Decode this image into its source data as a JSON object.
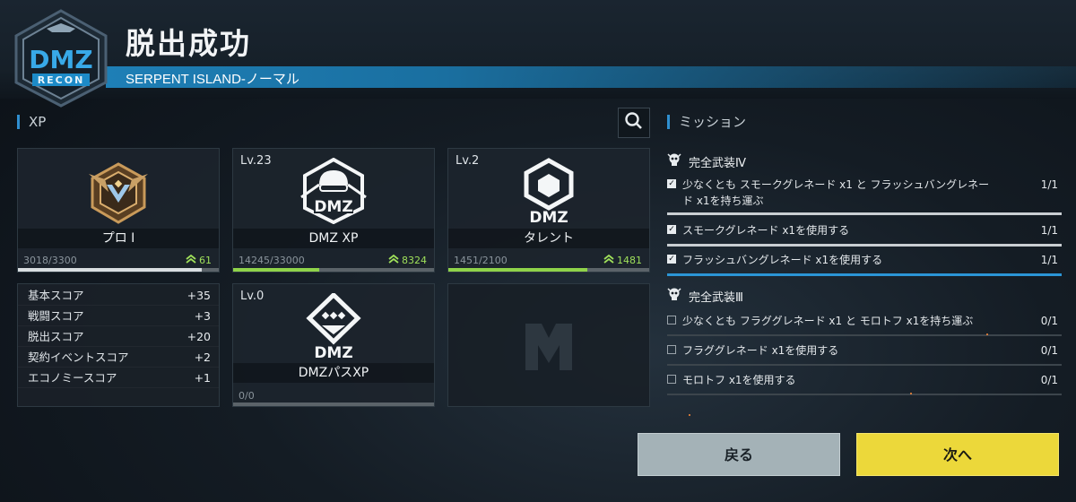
{
  "header": {
    "logo_text": "DMZ",
    "logo_subtext": "RECON",
    "title": "脱出成功",
    "subtitle": "SERPENT ISLAND-ノーマル"
  },
  "xp_section": {
    "label": "XP",
    "search_icon": "search-icon",
    "cards": [
      {
        "level": "",
        "name": "プロ I",
        "progress_text": "3018/3300",
        "progress": 0.915,
        "gain": "61",
        "icon": "rank-emblem-icon"
      },
      {
        "level": "Lv.23",
        "name": "DMZ XP",
        "progress_text": "14245/33000",
        "progress": 0.43,
        "gain": "8324",
        "icon": "dmz-operator-icon"
      },
      {
        "level": "Lv.2",
        "name": "タレント",
        "progress_text": "1451/2100",
        "progress": 0.69,
        "gain": "1481",
        "icon": "dmz-talent-icon"
      },
      {
        "level": "Lv.0",
        "name": "DMZパスXP",
        "progress_text": "0/0",
        "progress": 0,
        "gain": "",
        "icon": "dmz-pass-icon"
      }
    ],
    "emblem_text": "DMZ",
    "scores": [
      {
        "label": "基本スコア",
        "value": "+35"
      },
      {
        "label": "戦闘スコア",
        "value": "+3"
      },
      {
        "label": "脱出スコア",
        "value": "+20"
      },
      {
        "label": "契約イベントスコア",
        "value": "+2"
      },
      {
        "label": "エコノミースコア",
        "value": "+1"
      }
    ]
  },
  "missions": {
    "label": "ミッション",
    "groups": [
      {
        "title": "完全武装Ⅳ",
        "items": [
          {
            "text_line1": "少なくとも スモークグレネード x1 と フラッシュバングレネー",
            "text_line2": "ド x1を持ち運ぶ",
            "count": "1/1",
            "checked": true
          },
          {
            "text_line1": "スモークグレネード x1を使用する",
            "text_line2": "",
            "count": "1/1",
            "checked": true
          },
          {
            "text_line1": "フラッシュバングレネード x1を使用する",
            "text_line2": "",
            "count": "1/1",
            "checked": true
          }
        ]
      },
      {
        "title": "完全武装Ⅲ",
        "items": [
          {
            "text_line1": "少なくとも フラググレネード x1 と モロトフ x1を持ち運ぶ",
            "text_line2": "",
            "count": "0/1",
            "checked": false
          },
          {
            "text_line1": "フラググレネード x1を使用する",
            "text_line2": "",
            "count": "0/1",
            "checked": false
          },
          {
            "text_line1": "モロトフ x1を使用する",
            "text_line2": "",
            "count": "0/1",
            "checked": false
          }
        ]
      }
    ]
  },
  "buttons": {
    "back": "戻る",
    "next": "次へ"
  },
  "colors": {
    "accent_blue": "#2b95d6",
    "xp_green": "#8fd34a",
    "next_yellow": "#ecd83a",
    "back_gray": "#a4b2b7"
  }
}
